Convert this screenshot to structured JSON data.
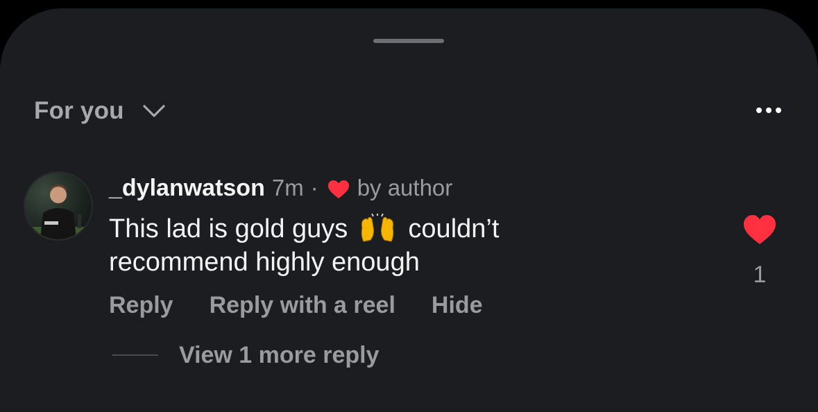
{
  "header": {
    "feed_label": "For you",
    "chevron_icon": "chevron-down-icon",
    "more_icon": "more-horizontal-icon"
  },
  "comment": {
    "username": "_dylanwatson",
    "time": "7m",
    "separator": "·",
    "liked_by_author_icon": "heart-icon",
    "liked_by_author_text": "by author",
    "text_before_emoji": "This lad is gold guys",
    "emoji": "raising-hands-emoji",
    "text_after_emoji": "couldn’t recommend highly enough",
    "like_icon": "heart-filled-icon",
    "like_count": "1",
    "actions": {
      "reply": "Reply",
      "reply_with_reel": "Reply with a reel",
      "hide": "Hide"
    },
    "view_replies": "View 1 more reply"
  },
  "colors": {
    "sheet_background": "#1c1d20",
    "primary_text": "#f4f4f5",
    "secondary_text": "#9a9ba0",
    "like_red": "#ff3040"
  }
}
